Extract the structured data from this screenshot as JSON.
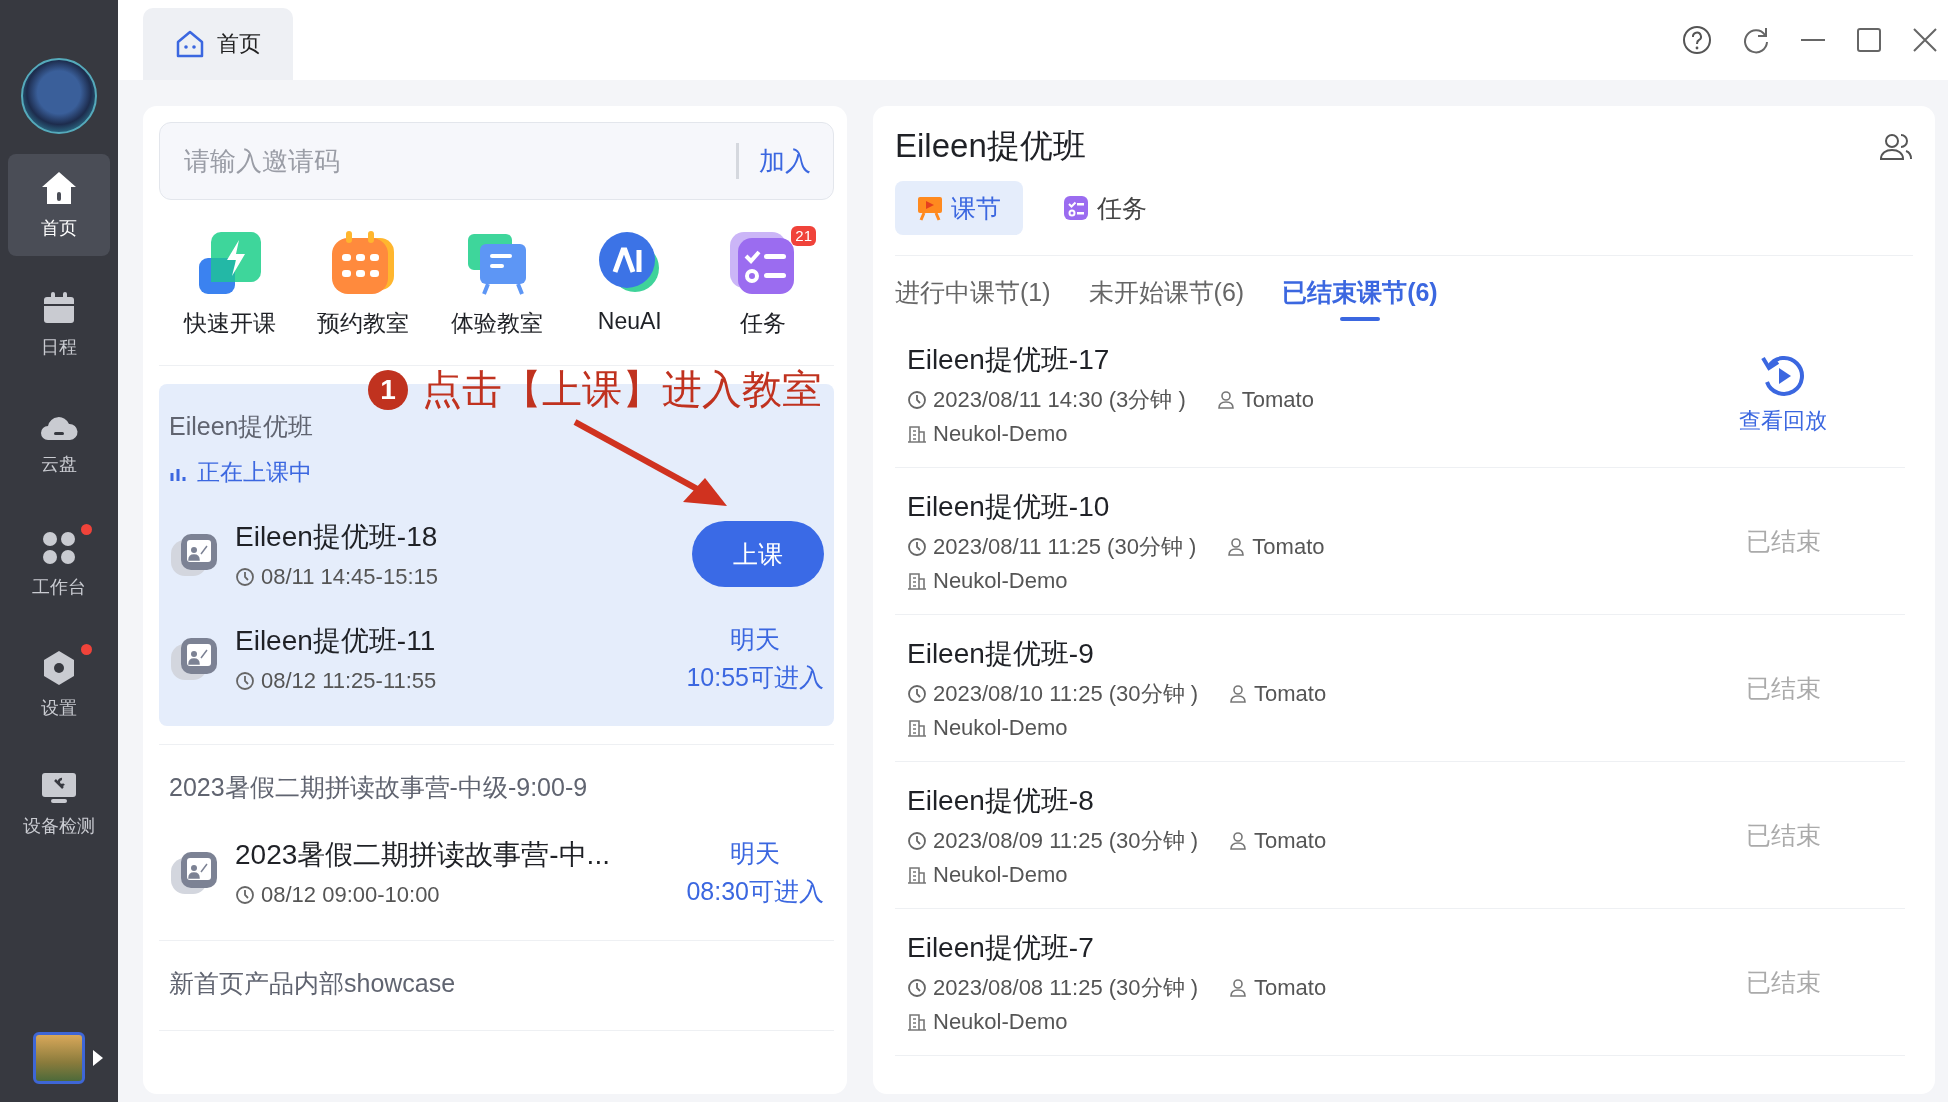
{
  "tabs": [
    {
      "label": "首页",
      "selected": true
    }
  ],
  "sidebar": {
    "items": [
      {
        "label": "首页",
        "selected": true,
        "dot": false,
        "kind": "home"
      },
      {
        "label": "日程",
        "selected": false,
        "dot": false,
        "kind": "calendar"
      },
      {
        "label": "云盘",
        "selected": false,
        "dot": false,
        "kind": "cloud"
      },
      {
        "label": "工作台",
        "selected": false,
        "dot": true,
        "kind": "apps"
      },
      {
        "label": "设置",
        "selected": false,
        "dot": true,
        "kind": "settings"
      },
      {
        "label": "设备检测",
        "selected": false,
        "dot": false,
        "kind": "device"
      }
    ]
  },
  "invite": {
    "placeholder": "请输入邀请码",
    "button": "加入"
  },
  "shortcuts": [
    {
      "label": "快速开课",
      "kind": "quick"
    },
    {
      "label": "预约教室",
      "kind": "booking"
    },
    {
      "label": "体验教室",
      "kind": "trial"
    },
    {
      "label": "NeuAI",
      "kind": "ai"
    },
    {
      "label": "任务",
      "kind": "task",
      "badge": "21"
    }
  ],
  "annotation": {
    "number": "1",
    "text": "点击【上课】进入教室"
  },
  "groups": [
    {
      "title": "Eileen提优班",
      "highlighted": true,
      "status": "正在上课中",
      "lessons": [
        {
          "title": "Eileen提优班-18",
          "time": "08/11 14:45-15:15",
          "action": {
            "kind": "button",
            "label": "上课"
          }
        },
        {
          "title": "Eileen提优班-11",
          "time": "08/12 11:25-11:55",
          "action": {
            "kind": "text",
            "lines": [
              "明天",
              "10:55可进入"
            ]
          }
        }
      ]
    },
    {
      "title": "2023暑假二期拼读故事营-中级-9:00-9",
      "highlighted": false,
      "lessons": [
        {
          "title": "2023暑假二期拼读故事营-中...",
          "time": "08/12 09:00-10:00",
          "action": {
            "kind": "text",
            "lines": [
              "明天",
              "08:30可进入"
            ]
          }
        }
      ]
    },
    {
      "title": "新首页产品内部showcase",
      "highlighted": false
    }
  ],
  "class_panel": {
    "title": "Eileen提优班",
    "tabs": [
      {
        "label": "课节",
        "selected": true,
        "kind": "lesson"
      },
      {
        "label": "任务",
        "selected": false,
        "kind": "task"
      }
    ],
    "subtabs": [
      {
        "label": "进行中课节(1)",
        "selected": false
      },
      {
        "label": "未开始课节(6)",
        "selected": false
      },
      {
        "label": "已结束课节(6)",
        "selected": true
      }
    ],
    "lessons": [
      {
        "title": "Eileen提优班-17",
        "time": "2023/08/11 14:30 (3分钟 )",
        "teacher": "Tomato",
        "org": "Neukol-Demo",
        "action": {
          "kind": "replay",
          "label": "查看回放"
        }
      },
      {
        "title": "Eileen提优班-10",
        "time": "2023/08/11 11:25 (30分钟 )",
        "teacher": "Tomato",
        "org": "Neukol-Demo",
        "action": {
          "kind": "ended",
          "label": "已结束"
        }
      },
      {
        "title": "Eileen提优班-9",
        "time": "2023/08/10 11:25 (30分钟 )",
        "teacher": "Tomato",
        "org": "Neukol-Demo",
        "action": {
          "kind": "ended",
          "label": "已结束"
        }
      },
      {
        "title": "Eileen提优班-8",
        "time": "2023/08/09 11:25 (30分钟 )",
        "teacher": "Tomato",
        "org": "Neukol-Demo",
        "action": {
          "kind": "ended",
          "label": "已结束"
        }
      },
      {
        "title": "Eileen提优班-7",
        "time": "2023/08/08 11:25 (30分钟 )",
        "teacher": "Tomato",
        "org": "Neukol-Demo",
        "action": {
          "kind": "ended",
          "label": "已结束"
        }
      }
    ]
  }
}
